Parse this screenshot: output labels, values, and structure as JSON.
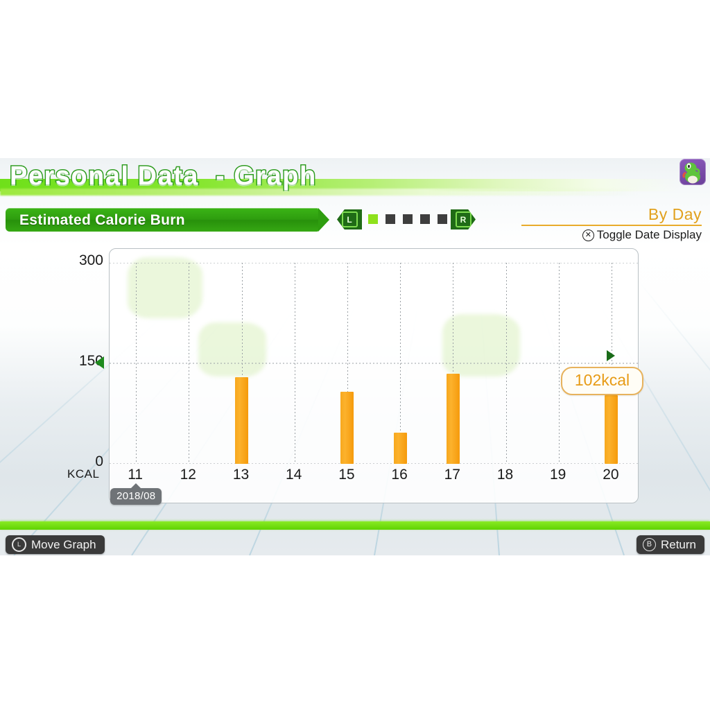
{
  "header": {
    "title": "Personal Data  - Graph",
    "avatar_icon": "yoshi-avatar-icon"
  },
  "subheader": {
    "metric_label": "Estimated Calorie Burn",
    "left_button": "L",
    "right_button": "R",
    "page_dots": 5,
    "active_page": 1,
    "mode_label": "By Day",
    "toggle_button_glyph": "✕",
    "toggle_label": "Toggle Date Display"
  },
  "callout": {
    "value_label": "102kcal"
  },
  "date_badge": {
    "label": "2018/08"
  },
  "footer": {
    "move_glyph": "L",
    "move_label": "Move Graph",
    "return_glyph": "B",
    "return_label": "Return"
  },
  "chart_data": {
    "type": "bar",
    "title": "Estimated Calorie Burn",
    "xlabel": "",
    "ylabel": "KCAL",
    "unit_label": "KCAL",
    "categories": [
      "11",
      "12",
      "13",
      "14",
      "15",
      "16",
      "17",
      "18",
      "19",
      "20"
    ],
    "values": [
      0,
      0,
      129,
      0,
      108,
      47,
      135,
      0,
      0,
      102
    ],
    "ylim": [
      0,
      300
    ],
    "yticks": [
      0,
      150,
      300
    ],
    "ytick_labels": [
      "0",
      "150",
      "300"
    ],
    "grid": true,
    "bar_color": "#f7a81e",
    "highlight_category": "20",
    "highlight_value_label": "102kcal",
    "marker_value": 150,
    "legend": []
  }
}
